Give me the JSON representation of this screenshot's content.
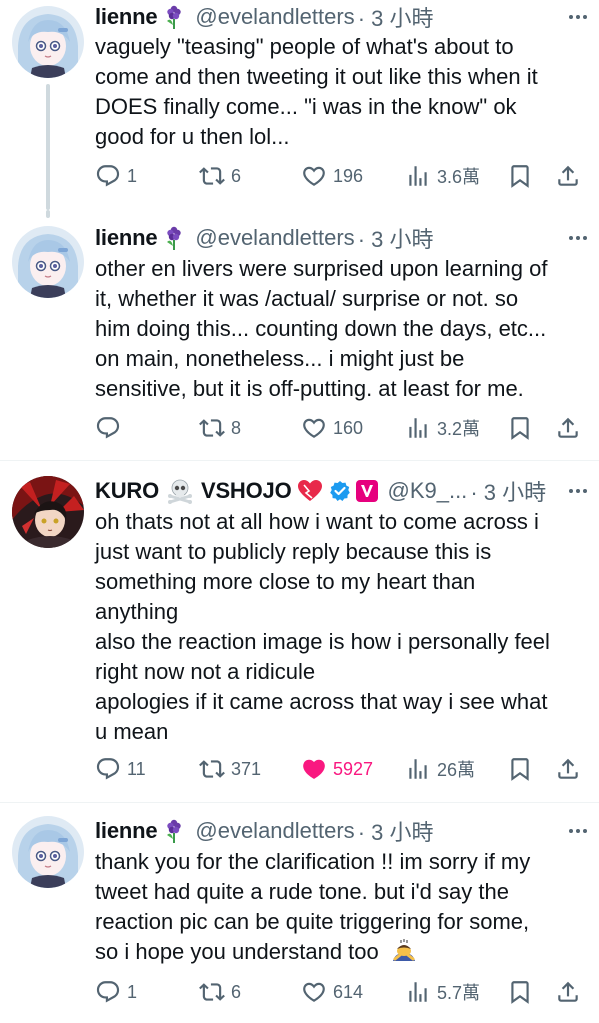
{
  "tweets": [
    {
      "name": "lienne",
      "name_emoji": "hyacinth-emoji",
      "handle": "@evelandletters",
      "time": "· 3 小時",
      "lines": [
        "vaguely \"teasing\" people of what's about to",
        "come and then tweeting it out like this when it",
        "DOES finally come... \"i was in the know\" ok",
        "good for u then lol..."
      ],
      "replies": "1",
      "reposts": "6",
      "likes": "196",
      "views": "3.6萬",
      "liked": false
    },
    {
      "name": "lienne",
      "name_emoji": "hyacinth-emoji",
      "handle": "@evelandletters",
      "time": "· 3 小時",
      "lines": [
        "other en livers were surprised upon learning of",
        "it, whether it was /actual/ surprise or not. so",
        "him doing this... counting down the days, etc...",
        "on main,  nonetheless... i might just be",
        "sensitive, but it is off-putting. at least for me."
      ],
      "replies": "",
      "reposts": "8",
      "likes": "160",
      "views": "3.2萬",
      "liked": false
    },
    {
      "name": "KURO",
      "name_emoji_1": "skull-crossbones-emoji",
      "name_2": "VSHOJO",
      "name_emoji_2": "heart-emoji",
      "badges": [
        "verified-badge",
        "vshojo-badge"
      ],
      "handle": "@K9_...",
      "time": "· 3 小時",
      "lines": [
        "oh thats not at all how i want to come across i",
        "just want to publicly reply because this is",
        "something more close to my heart than",
        "anything",
        "also the reaction image is how i personally feel",
        "right now not a ridicule",
        "apologies if it came across that way i see what",
        "u mean"
      ],
      "replies": "11",
      "reposts": "371",
      "likes": "5927",
      "views": "26萬",
      "liked": true
    },
    {
      "name": "lienne",
      "name_emoji": "hyacinth-emoji",
      "handle": "@evelandletters",
      "time": "· 3 小時",
      "lines": [
        "thank you for the clarification !! im sorry if my",
        "tweet had quite a rude tone. but i'd say the",
        "reaction pic can be quite triggering for some,",
        "so i hope you understand too"
      ],
      "trailing_emoji": "bowing-person-emoji",
      "replies": "1",
      "reposts": "6",
      "likes": "614",
      "views": "5.7萬",
      "liked": false
    }
  ],
  "colors": {
    "text": "#0f1419",
    "secondary": "#536471",
    "like_active": "#f91880",
    "verified": "#1d9bf0",
    "vshojo": "#e6007e",
    "thread_line": "#cfd9de"
  }
}
